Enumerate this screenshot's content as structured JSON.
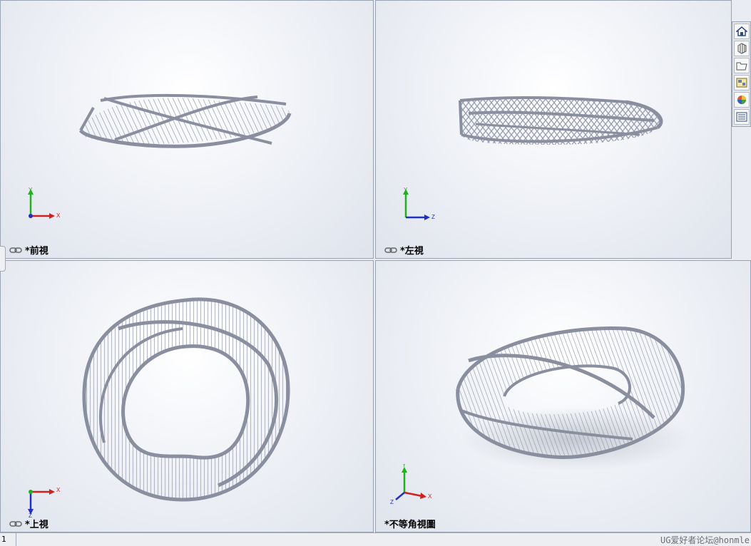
{
  "toolbar": {
    "icons": [
      "zoom-to-fit-icon",
      "zoom-to-area-icon",
      "previous-view-icon",
      "section-view-icon",
      "dynamic-annotation-icon",
      "view-orientation-icon",
      "display-style-icon",
      "hide-show-items-icon",
      "edit-appearance-icon",
      "apply-scene-icon",
      "view-settings-icon"
    ]
  },
  "viewports": {
    "front": {
      "label": "*前視",
      "axis_h": "X",
      "axis_v": "Y"
    },
    "left": {
      "label": "*左視",
      "axis_h": "Z",
      "axis_v": "Y"
    },
    "top": {
      "label": "*上視",
      "axis_h": "X",
      "axis_v": "Z"
    },
    "iso": {
      "label": "*不等角視圖",
      "axis_h": "X",
      "axis_v": "Y",
      "axis_d": "Z"
    }
  },
  "task_pane": {
    "icons": [
      "home-icon",
      "design-library-icon",
      "file-explorer-icon",
      "view-palette-icon",
      "appearances-icon",
      "custom-properties-icon"
    ]
  },
  "statusbar": {
    "page": "1",
    "watermark": "UG爱好者论坛@honmle"
  },
  "colors": {
    "model": "#8e93a3",
    "model_dark": "#6f7485",
    "axis_x": "#d02020",
    "axis_y": "#20b020",
    "axis_z": "#2030c0"
  }
}
